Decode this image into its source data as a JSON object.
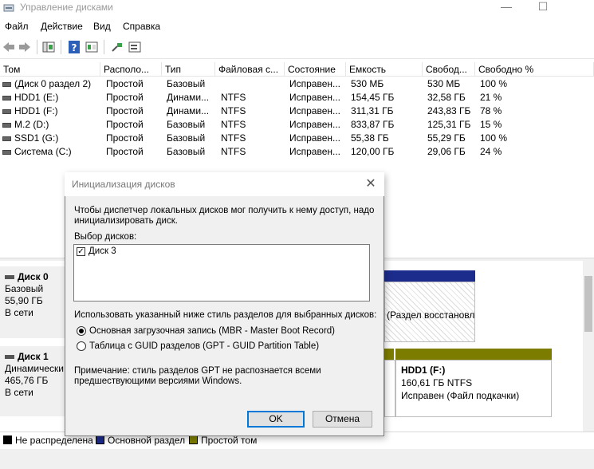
{
  "window": {
    "title": "Управление дисками",
    "controls": {
      "minimize": "—",
      "maximize": "☐"
    }
  },
  "menu": [
    "Файл",
    "Действие",
    "Вид",
    "Справка"
  ],
  "toolbar": [
    "back-icon",
    "forward-icon",
    "console-tree-icon",
    "help-icon",
    "properties-icon",
    "connect-icon",
    "settings-icon"
  ],
  "volumes": {
    "columns": [
      "Том",
      "Располо...",
      "Тип",
      "Файловая с...",
      "Состояние",
      "Емкость",
      "Свобод...",
      "Свободно %"
    ],
    "rows": [
      [
        "(Диск 0 раздел 2)",
        "Простой",
        "Базовый",
        "",
        "Исправен...",
        "530 МБ",
        "530 МБ",
        "100 %"
      ],
      [
        "HDD1 (E:)",
        "Простой",
        "Динами...",
        "NTFS",
        "Исправен...",
        "154,45 ГБ",
        "32,58 ГБ",
        "21 %"
      ],
      [
        "HDD1 (F:)",
        "Простой",
        "Динами...",
        "NTFS",
        "Исправен...",
        "311,31 ГБ",
        "243,83 ГБ",
        "78 %"
      ],
      [
        "M.2 (D:)",
        "Простой",
        "Базовый",
        "NTFS",
        "Исправен...",
        "833,87 ГБ",
        "125,31 ГБ",
        "15 %"
      ],
      [
        "SSD1 (G:)",
        "Простой",
        "Базовый",
        "NTFS",
        "Исправен...",
        "55,38 ГБ",
        "55,29 ГБ",
        "100 %"
      ],
      [
        "Система (C:)",
        "Простой",
        "Базовый",
        "NTFS",
        "Исправен...",
        "120,00 ГБ",
        "29,06 ГБ",
        "24 %"
      ]
    ]
  },
  "disks": [
    {
      "name": "Диск 0",
      "type": "Базовый",
      "size": "55,90 ГБ",
      "status": "В сети",
      "partition_text": "(Раздел восстановл"
    },
    {
      "name": "Диск 1",
      "type": "Динамически",
      "size": "465,76 ГБ",
      "status": "В сети",
      "partition": {
        "name": "HDD1  (F:)",
        "fs": "160,61 ГБ NTFS",
        "status": "Исправен (Файл подкачки)"
      }
    }
  ],
  "legend": [
    {
      "label": "Не распределена",
      "color": "#000000"
    },
    {
      "label": "Основной раздел",
      "color": "#1c2c8c"
    },
    {
      "label": "Простой том",
      "color": "#7c7c00"
    }
  ],
  "dialog": {
    "title": "Инициализация дисков",
    "intro": "Чтобы диспетчер локальных дисков мог получить к нему доступ, надо инициализировать диск.",
    "select_label": "Выбор дисков:",
    "disk_item": "Диск 3",
    "disk_checked": true,
    "style_label": "Использовать указанный ниже стиль разделов для выбранных дисков:",
    "mbr_label": "Основная загрузочная запись (MBR - Master Boot Record)",
    "gpt_label": "Таблица с GUID разделов (GPT - GUID Partition Table)",
    "selected_style": "MBR",
    "note": "Примечание: стиль разделов GPT не распознается всеми предшествующими версиями Windows.",
    "ok": "OK",
    "cancel": "Отмена"
  }
}
